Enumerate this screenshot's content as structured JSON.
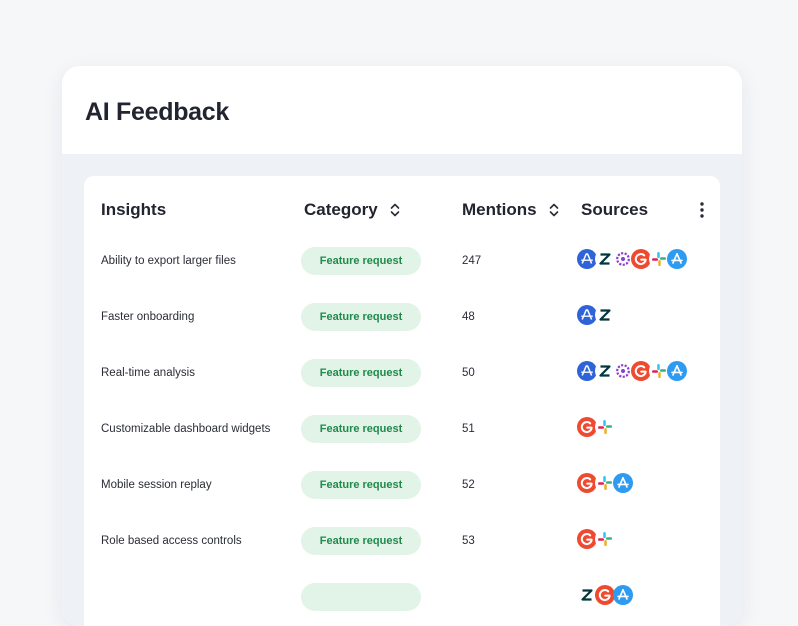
{
  "header": {
    "title": "AI Feedback"
  },
  "table": {
    "columns": {
      "insights": "Insights",
      "category": "Category",
      "mentions": "Mentions",
      "sources": "Sources"
    },
    "rows": [
      {
        "insight": "Ability to export larger files",
        "category": "Feature request",
        "mentions": "247",
        "sources": [
          "amplitude-icon",
          "zendesk-icon",
          "gong-icon",
          "g2-icon",
          "slack-icon",
          "app-store-icon"
        ]
      },
      {
        "insight": "Faster onboarding",
        "category": "Feature request",
        "mentions": "48",
        "sources": [
          "amplitude-icon",
          "zendesk-icon"
        ]
      },
      {
        "insight": "Real-time analysis",
        "category": "Feature request",
        "mentions": "50",
        "sources": [
          "amplitude-icon",
          "zendesk-icon",
          "gong-icon",
          "g2-icon",
          "slack-icon",
          "app-store-icon"
        ]
      },
      {
        "insight": "Customizable dashboard widgets",
        "category": "Feature request",
        "mentions": "51",
        "sources": [
          "g2-icon",
          "slack-icon"
        ]
      },
      {
        "insight": "Mobile session replay",
        "category": "Feature request",
        "mentions": "52",
        "sources": [
          "g2-icon",
          "slack-icon",
          "app-store-icon"
        ]
      },
      {
        "insight": "Role based access controls",
        "category": "Feature request",
        "mentions": "53",
        "sources": [
          "g2-icon",
          "slack-icon"
        ]
      },
      {
        "insight": "",
        "category": "",
        "mentions": "",
        "sources": [
          "zendesk-icon",
          "g2-icon",
          "app-store-icon"
        ]
      }
    ]
  },
  "colors": {
    "pill_bg": "#e2f3e8",
    "pill_text": "#1f8a4c",
    "amplitude": "#2f64d8",
    "g2": "#ef4a2f",
    "app_store": "#2f9bf0",
    "gong": "#8b3fd1"
  }
}
